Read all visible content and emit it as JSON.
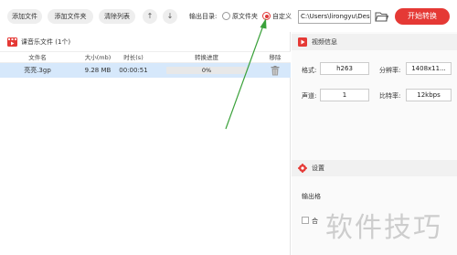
{
  "toolbar": {
    "add_file": "添加文件",
    "add_folder": "添加文件夹",
    "clear_list": "清除列表",
    "move_up_icon": "arrow-up",
    "move_down_icon": "arrow-down",
    "up_glyph": "↑",
    "down_glyph": "↓",
    "output_dir_label": "输出目录:",
    "source_folder_label": "原文件夹",
    "custom_label": "自定义",
    "output_path": "C:\\Users\\lirongyu\\Desk",
    "start_label": "开始转换",
    "accent": "#e53935"
  },
  "file_list": {
    "title": "课音乐文件 (1个)",
    "columns": [
      "文件名",
      "大小(mb)",
      "时长(s)",
      "转换进度",
      "移除"
    ],
    "rows": [
      {
        "name": "亮亮.3gp",
        "size": "9.28 MB",
        "duration": "00:00:51",
        "progress": "0%"
      }
    ]
  },
  "video_info": {
    "title": "视频信息",
    "format_label": "格式:",
    "format_value": "h263",
    "resolution_label": "分辨率:",
    "resolution_value": "1408x11...",
    "channels_label": "声道:",
    "channels_value": "1",
    "bitrate_label": "比特率:",
    "bitrate_value": "12kbps"
  },
  "settings": {
    "title": "设置",
    "output_format_label": "输出格",
    "merge_label": "合"
  },
  "watermark": "软件技巧"
}
